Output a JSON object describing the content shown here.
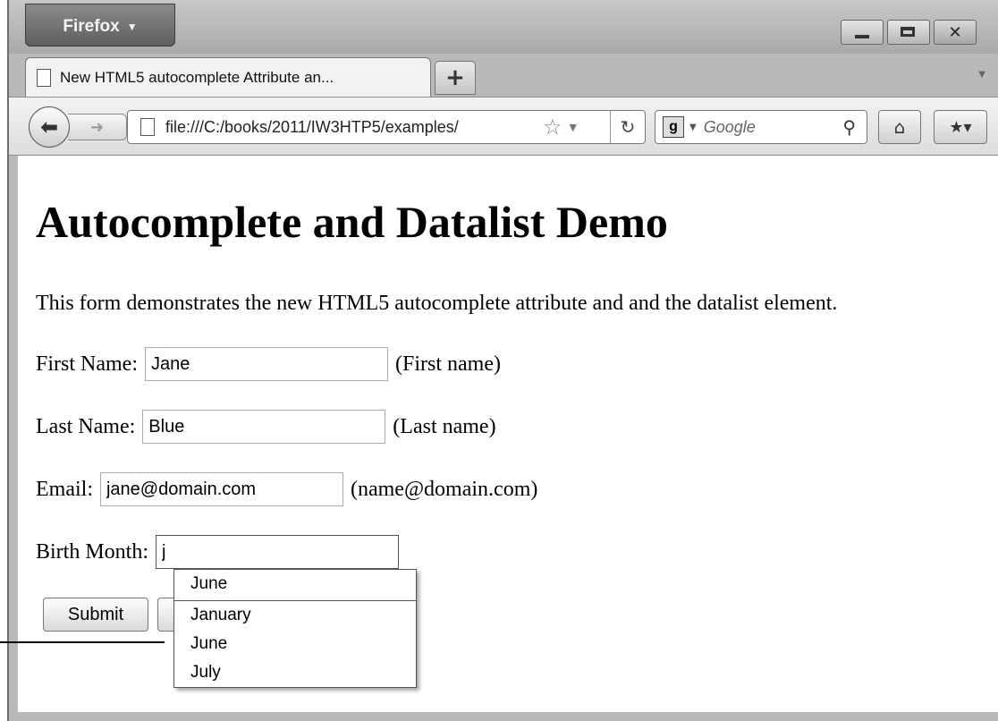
{
  "browser": {
    "menu_button": "Firefox",
    "window_controls": {
      "minimize": "–",
      "maximize": "▢",
      "close": "✕"
    },
    "tab": {
      "title": "New HTML5 autocomplete Attribute an...",
      "icon": "page-icon"
    },
    "new_tab": "+",
    "url": "file:///C:/books/2011/IW3HTP5/examples/",
    "search_placeholder": "Google",
    "icons": {
      "back": "back-arrow-icon",
      "forward": "forward-arrow-icon",
      "reload": "reload-icon",
      "home": "home-icon",
      "bookmarks": "bookmarks-icon",
      "search": "magnifier-icon",
      "star": "star-icon"
    }
  },
  "page": {
    "heading": "Autocomplete and Datalist Demo",
    "intro": "This form demonstrates the new HTML5 autocomplete attribute and and the datalist element.",
    "fields": [
      {
        "label": "First Name:",
        "value": "Jane",
        "hint": "(First name)"
      },
      {
        "label": "Last Name:",
        "value": "Blue",
        "hint": "(Last name)"
      },
      {
        "label": "Email:",
        "value": "jane@domain.com",
        "hint": "(name@domain.com)"
      },
      {
        "label": "Birth Month:",
        "value": "j"
      }
    ],
    "submit_label": "Submit",
    "dropdown": {
      "history": "June",
      "options": [
        "January",
        "June",
        "July"
      ]
    }
  }
}
